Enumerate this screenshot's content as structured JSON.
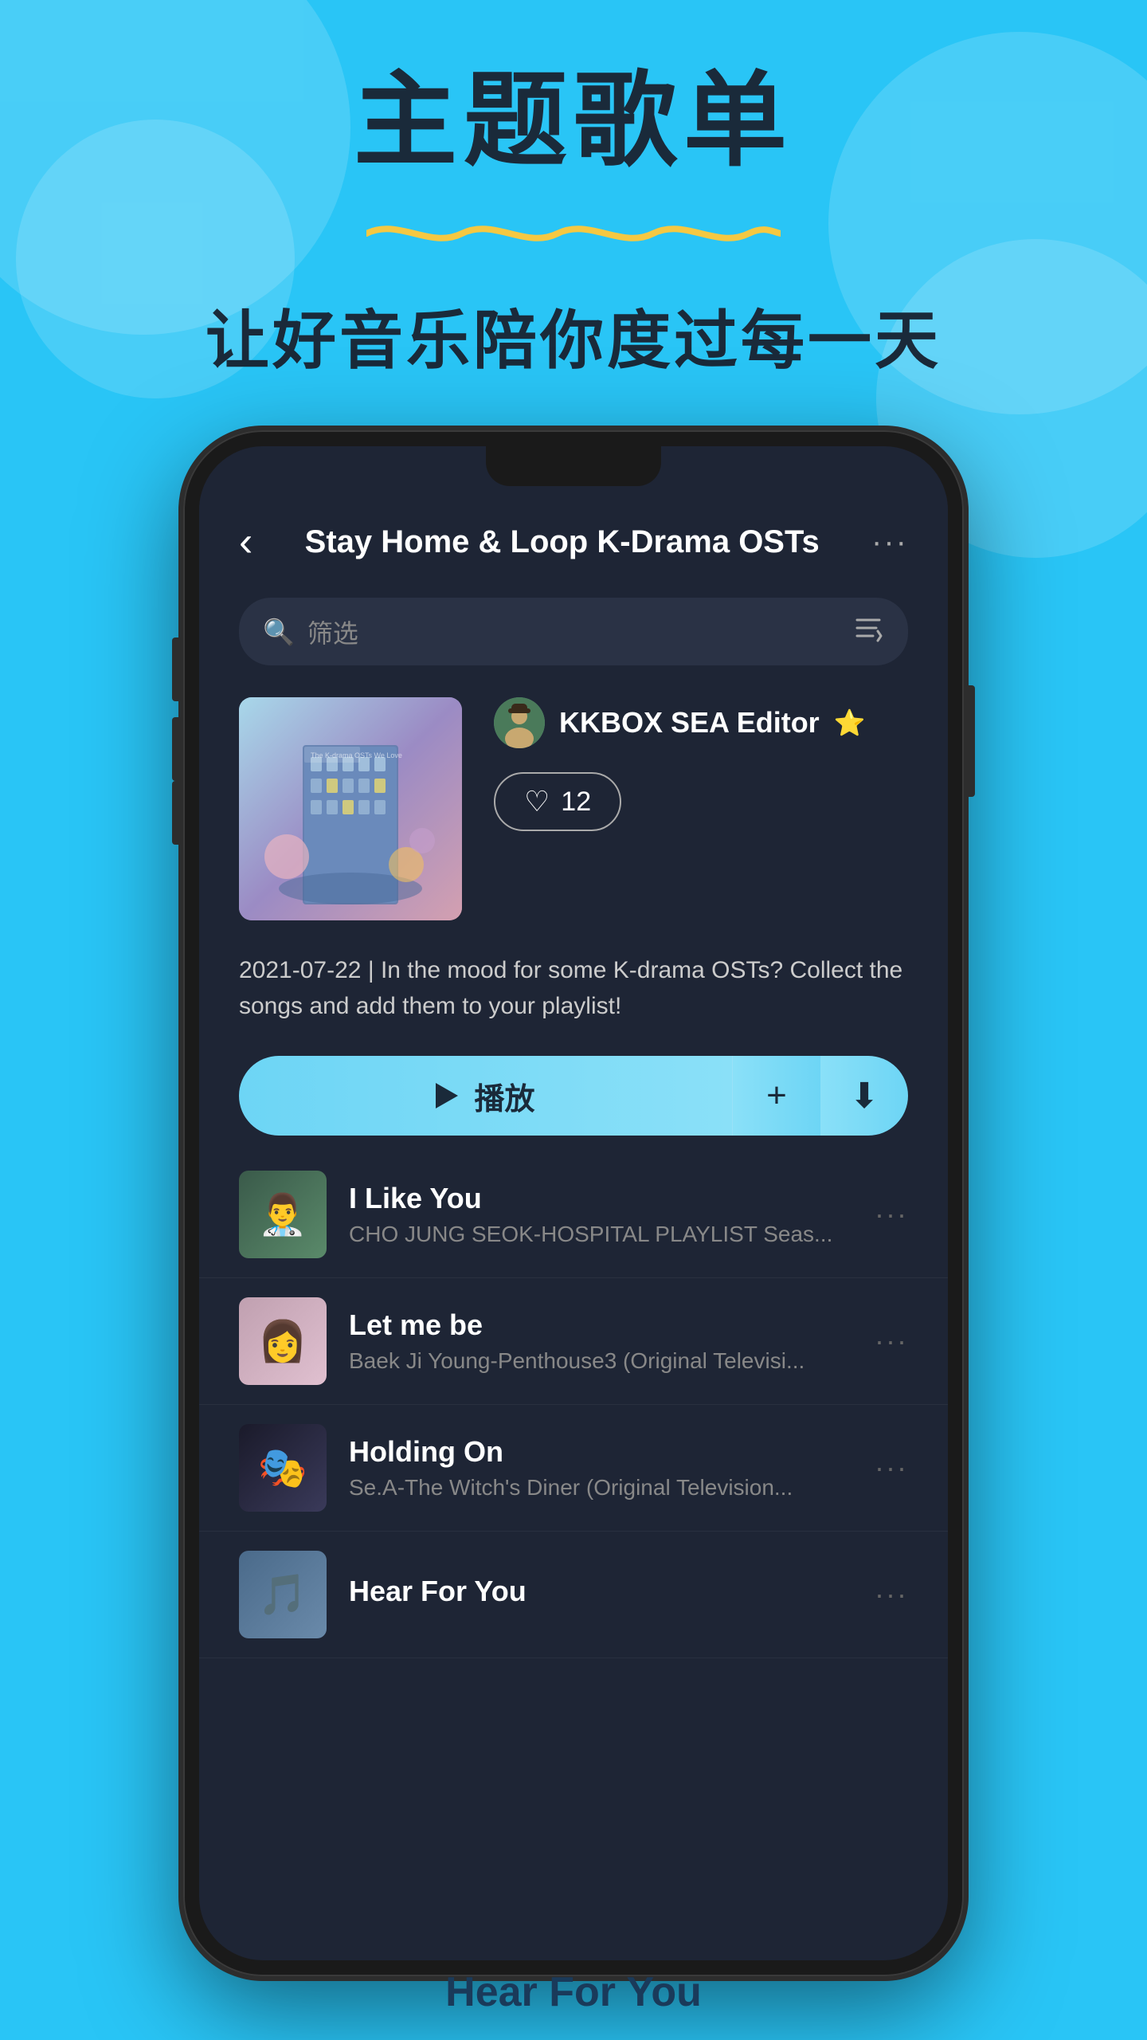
{
  "background": {
    "color": "#29c5f6"
  },
  "header": {
    "main_title": "主题歌单",
    "subtitle": "让好音乐陪你度过每一天"
  },
  "phone": {
    "app_header": {
      "back_label": "‹",
      "title": "Stay Home & Loop K-Drama OSTs",
      "more_label": "···"
    },
    "search": {
      "placeholder": "筛选",
      "sort_icon": "sort"
    },
    "playlist": {
      "editor_name": "KKBOX SEA Editor",
      "editor_star": "⭐",
      "likes_count": "12",
      "date": "2021-07-22",
      "description": "In the mood for some K-drama OSTs? Collect the songs and add them to your playlist!",
      "play_label": "播放",
      "add_label": "+",
      "download_label": "⬇"
    },
    "songs": [
      {
        "title": "I Like You",
        "subtitle": "CHO JUNG SEOK-HOSPITAL PLAYLIST Seas...",
        "thumb_color": "thumb-1"
      },
      {
        "title": "Let me be",
        "subtitle": "Baek Ji Young-Penthouse3 (Original Televisi...",
        "thumb_color": "thumb-2"
      },
      {
        "title": "Holding On",
        "subtitle": "Se.A-The Witch's Diner (Original Television...",
        "thumb_color": "thumb-3"
      },
      {
        "title": "Hear For You",
        "subtitle": "",
        "thumb_color": "thumb-4"
      }
    ]
  },
  "bottom": {
    "app_name": "Hear For You"
  }
}
